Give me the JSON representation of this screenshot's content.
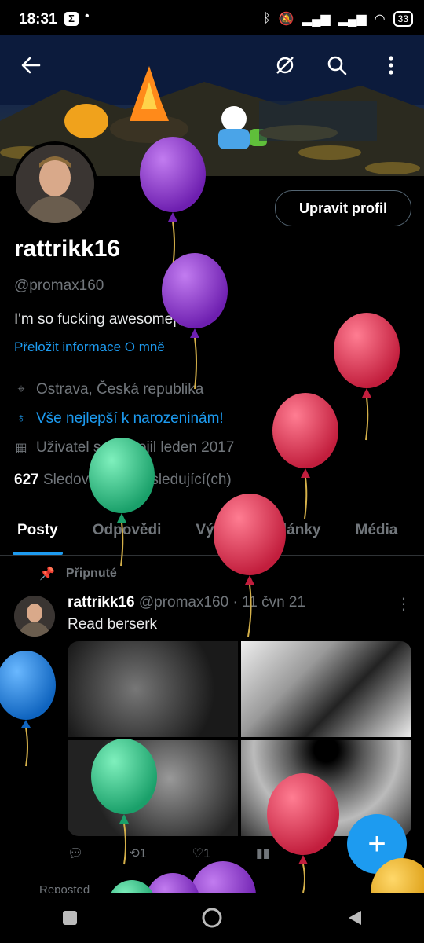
{
  "status": {
    "time": "18:31",
    "app_icon_glyph": "Σ",
    "dot": "•",
    "battery": "33"
  },
  "header": {
    "back_icon": "arrow-left-icon",
    "icons": [
      "no-notifications-icon",
      "search-icon",
      "more-vertical-icon"
    ]
  },
  "profile": {
    "edit_label": "Upravit profil",
    "name": "rattrikk16",
    "handle": "@promax160",
    "bio": "I'm so fucking awesome|@|",
    "translate": "Přeložit informace O mně",
    "location": "Ostrava, Česká republika",
    "birthday": "Vše nejlepší k narozeninám!",
    "joined": "Uživatel se připojil leden 2017",
    "following_count": "627",
    "following_label": "Sledování",
    "followers_count": "39",
    "followers_label": "sledující(ch)"
  },
  "tabs": [
    "Posty",
    "Odpovědi",
    "Výběr",
    "Články",
    "Média"
  ],
  "post": {
    "pinned_label": "Připnuté",
    "name": "rattrikk16",
    "handle": "@promax160",
    "sep": "·",
    "date": "11 čvn 21",
    "text": "Read berserk",
    "reply_count": "",
    "repost_count": "1",
    "like_count": "1"
  },
  "repost_label": "Reposted",
  "colors": {
    "accent": "#1d9bf0",
    "balloon_purple": "#8a2bd6",
    "balloon_red": "#e0314f",
    "balloon_green": "#2fd08b",
    "balloon_blue": "#1e88e5",
    "balloon_yellow": "#f2b51a"
  }
}
